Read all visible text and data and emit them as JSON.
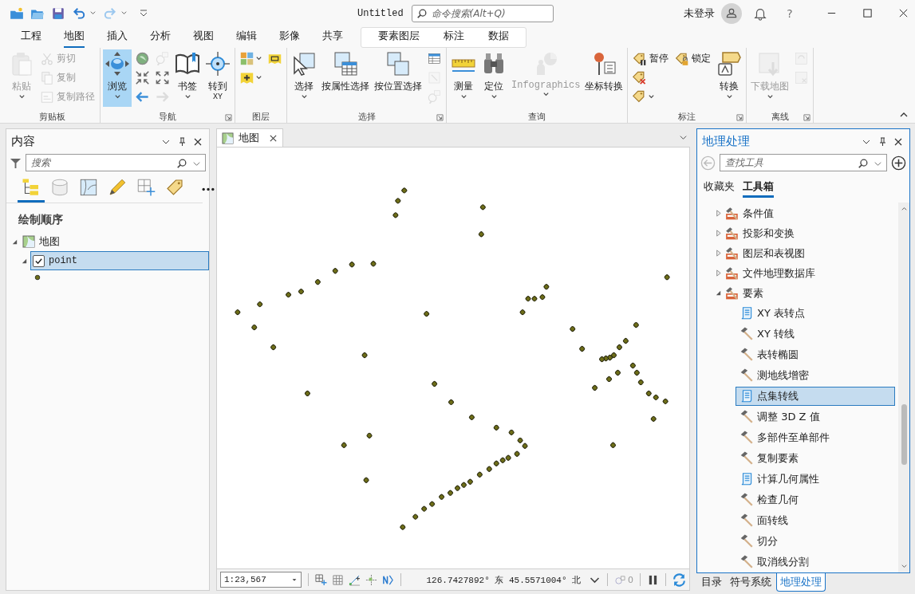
{
  "window": {
    "title": "Untitled",
    "command_search": {
      "placeholder": "命令搜索(Alt+Q)"
    },
    "user": "未登录",
    "help": "?"
  },
  "ribbon_tabs": [
    {
      "label": "工程",
      "kind": "core",
      "selected": false
    },
    {
      "label": "地图",
      "kind": "core",
      "selected": true
    },
    {
      "label": "插入",
      "kind": "core",
      "selected": false
    },
    {
      "label": "分析",
      "kind": "core",
      "selected": false
    },
    {
      "label": "视图",
      "kind": "core",
      "selected": false
    },
    {
      "label": "编辑",
      "kind": "core",
      "selected": false
    },
    {
      "label": "影像",
      "kind": "core",
      "selected": false
    },
    {
      "label": "共享",
      "kind": "core",
      "selected": false
    },
    {
      "label": "要素图层",
      "kind": "contextual",
      "selected": false
    },
    {
      "label": "标注",
      "kind": "contextual",
      "selected": false
    },
    {
      "label": "数据",
      "kind": "contextual",
      "selected": false
    }
  ],
  "ribbon_groups": [
    {
      "title": "剪贴板",
      "launcher": false,
      "columns": [
        [
          {
            "kind": "large",
            "label": "粘贴",
            "dropdown": true,
            "disabled": true,
            "active": false
          }
        ],
        [
          {
            "kind": "small",
            "label": "剪切",
            "dropdown": false,
            "disabled": true,
            "active": false
          },
          {
            "kind": "small",
            "label": "复制",
            "dropdown": false,
            "disabled": true,
            "active": false
          },
          {
            "kind": "small",
            "label": "复制路径",
            "dropdown": false,
            "disabled": true,
            "active": false
          }
        ]
      ]
    },
    {
      "title": "导航",
      "launcher": true,
      "columns": [
        [
          {
            "kind": "large",
            "label": "浏览",
            "dropdown": true,
            "disabled": false,
            "active": true
          }
        ],
        [
          {
            "kind": "icon",
            "dropdown": false,
            "disabled": false,
            "active": false
          },
          {
            "kind": "icon",
            "dropdown": false,
            "disabled": false,
            "active": false
          },
          {
            "kind": "icon",
            "dropdown": false,
            "disabled": false,
            "active": false
          }
        ],
        [
          {
            "kind": "icon",
            "dropdown": false,
            "disabled": true,
            "active": false
          },
          {
            "kind": "icon",
            "dropdown": false,
            "disabled": false,
            "active": false
          },
          {
            "kind": "icon",
            "dropdown": false,
            "disabled": true,
            "active": false
          }
        ],
        [
          {
            "kind": "large",
            "label": "书签",
            "dropdown": true,
            "disabled": false,
            "active": false
          }
        ],
        [
          {
            "kind": "large",
            "label": "转到",
            "sublabel": "XY",
            "dropdown": false,
            "disabled": false,
            "active": false
          }
        ]
      ]
    },
    {
      "title": "图层",
      "launcher": false,
      "columns": [
        [
          {
            "kind": "icon",
            "dropdown": true,
            "disabled": false,
            "active": false
          },
          {
            "kind": "icon",
            "dropdown": true,
            "disabled": false,
            "active": false
          }
        ],
        [
          {
            "kind": "icon",
            "dropdown": false,
            "disabled": false,
            "active": false
          }
        ]
      ]
    },
    {
      "title": "选择",
      "launcher": true,
      "columns": [
        [
          {
            "kind": "large",
            "label": "选择",
            "dropdown": true,
            "disabled": false,
            "active": false
          }
        ],
        [
          {
            "kind": "large",
            "label": "按属性选择",
            "dropdown": false,
            "disabled": false,
            "active": false
          }
        ],
        [
          {
            "kind": "large",
            "label": "按位置选择",
            "dropdown": false,
            "disabled": false,
            "active": false
          }
        ],
        [
          {
            "kind": "icon",
            "dropdown": false,
            "disabled": false,
            "active": false
          },
          {
            "kind": "icon",
            "dropdown": false,
            "disabled": true,
            "active": false
          },
          {
            "kind": "icon",
            "dropdown": false,
            "disabled": true,
            "active": false
          }
        ]
      ]
    },
    {
      "title": "查询",
      "launcher": false,
      "columns": [
        [
          {
            "kind": "large",
            "label": "测量",
            "dropdown": true,
            "disabled": false,
            "active": false
          }
        ],
        [
          {
            "kind": "large",
            "label": "定位",
            "dropdown": true,
            "disabled": false,
            "active": false
          }
        ],
        [
          {
            "kind": "large",
            "label": "Infographics",
            "dropdown": true,
            "disabled": true,
            "active": false
          }
        ],
        [
          {
            "kind": "large",
            "label": "坐标转换",
            "dropdown": false,
            "disabled": false,
            "active": false
          }
        ]
      ]
    },
    {
      "title": "标注",
      "launcher": true,
      "columns": [
        [
          {
            "kind": "small",
            "label": "暂停",
            "dropdown": false,
            "disabled": false,
            "active": false
          },
          {
            "kind": "icon",
            "dropdown": false,
            "disabled": false,
            "active": false
          },
          {
            "kind": "icon",
            "dropdown": true,
            "disabled": false,
            "active": false
          }
        ],
        [
          {
            "kind": "small",
            "label": "锁定",
            "dropdown": false,
            "disabled": false,
            "active": false
          }
        ],
        [
          {
            "kind": "large",
            "label": "转换",
            "dropdown": true,
            "disabled": false,
            "active": false
          }
        ]
      ]
    },
    {
      "title": "离线",
      "launcher": true,
      "columns": [
        [
          {
            "kind": "large",
            "label": "下载地图",
            "dropdown": true,
            "disabled": true,
            "active": false
          }
        ],
        [
          {
            "kind": "icon",
            "dropdown": false,
            "disabled": true,
            "active": false
          },
          {
            "kind": "icon",
            "dropdown": false,
            "disabled": true,
            "active": false
          }
        ]
      ]
    }
  ],
  "contents_pane": {
    "title": "内容",
    "search": {
      "placeholder": "搜索"
    },
    "view_tabs": [
      {
        "selected": true
      },
      {
        "selected": false
      },
      {
        "selected": false
      },
      {
        "selected": false
      },
      {
        "selected": false
      },
      {
        "selected": false
      }
    ],
    "section": "绘制顺序",
    "tree": [
      {
        "label": "地图",
        "expanded": true,
        "children": [
          {
            "label": "point",
            "checked": true,
            "selected": true,
            "expanded": true
          }
        ]
      }
    ]
  },
  "map_view": {
    "tabs": [
      {
        "label": "地图",
        "selected": true
      }
    ],
    "status_bar": {
      "scale": "1:23,567",
      "coordinates": "126.7427892° 东 45.5571004° 北",
      "selected_count": "0"
    }
  },
  "geoprocessing_pane": {
    "title": "地理处理",
    "search": {
      "placeholder": "查找工具"
    },
    "tabs": [
      {
        "label": "收藏夹",
        "selected": false
      },
      {
        "label": "工具箱",
        "selected": true
      }
    ],
    "toolsets": [
      {
        "label": "条件值",
        "expanded": false
      },
      {
        "label": "投影和变换",
        "expanded": false
      },
      {
        "label": "图层和表视图",
        "expanded": false
      },
      {
        "label": "文件地理数据库",
        "expanded": false
      },
      {
        "label": "要素",
        "expanded": true,
        "children": [
          {
            "label": "XY 表转点",
            "kind": "script",
            "selected": false
          },
          {
            "label": "XY 转线",
            "kind": "tool",
            "selected": false
          },
          {
            "label": "表转椭圆",
            "kind": "tool",
            "selected": false
          },
          {
            "label": "测地线增密",
            "kind": "tool",
            "selected": false
          },
          {
            "label": "点集转线",
            "kind": "script",
            "selected": true
          },
          {
            "label": "调整 3D Z 值",
            "kind": "tool",
            "selected": false
          },
          {
            "label": "多部件至单部件",
            "kind": "tool",
            "selected": false
          },
          {
            "label": "复制要素",
            "kind": "tool",
            "selected": false
          },
          {
            "label": "计算几何属性",
            "kind": "script",
            "selected": false
          },
          {
            "label": "检查几何",
            "kind": "tool",
            "selected": false
          },
          {
            "label": "面转线",
            "kind": "tool",
            "selected": false
          },
          {
            "label": "切分",
            "kind": "tool",
            "selected": false
          },
          {
            "label": "取消线分割",
            "kind": "tool",
            "selected": false
          }
        ]
      }
    ]
  },
  "dock_tabs": [
    {
      "label": "目录",
      "selected": false
    },
    {
      "label": "符号系统",
      "selected": false
    },
    {
      "label": "地理处理",
      "selected": true
    }
  ]
}
